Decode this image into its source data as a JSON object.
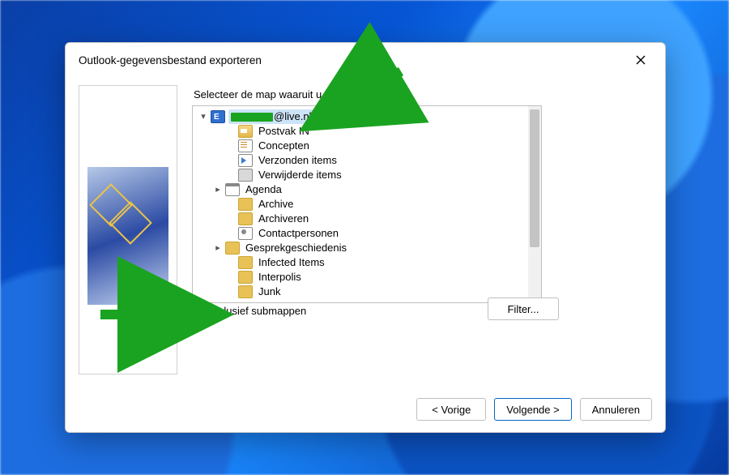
{
  "window": {
    "title": "Outlook-gegevensbestand exporteren"
  },
  "prompt": "Selecteer de map waaruit u wilt exporteren:",
  "account": {
    "visible_suffix": "@live.nl"
  },
  "tree": {
    "items": [
      {
        "label": "Postvak IN",
        "icon": "inbox"
      },
      {
        "label": "Concepten",
        "icon": "draft"
      },
      {
        "label": "Verzonden items",
        "icon": "sent"
      },
      {
        "label": "Verwijderde items",
        "icon": "trash"
      },
      {
        "label": "Agenda",
        "icon": "calendar",
        "expandable": true
      },
      {
        "label": "Archive",
        "icon": "folder"
      },
      {
        "label": "Archiveren",
        "icon": "folder"
      },
      {
        "label": "Contactpersonen",
        "icon": "contacts"
      },
      {
        "label": "Gesprekgeschiedenis",
        "icon": "folder",
        "expandable": true
      },
      {
        "label": "Infected Items",
        "icon": "folder"
      },
      {
        "label": "Interpolis",
        "icon": "folder"
      },
      {
        "label": "Junk",
        "icon": "folder"
      }
    ]
  },
  "checkbox": {
    "label": "Inclusief submappen",
    "checked": true
  },
  "buttons": {
    "filter": "Filter...",
    "back": "< Vorige",
    "next": "Volgende >",
    "cancel": "Annuleren"
  }
}
